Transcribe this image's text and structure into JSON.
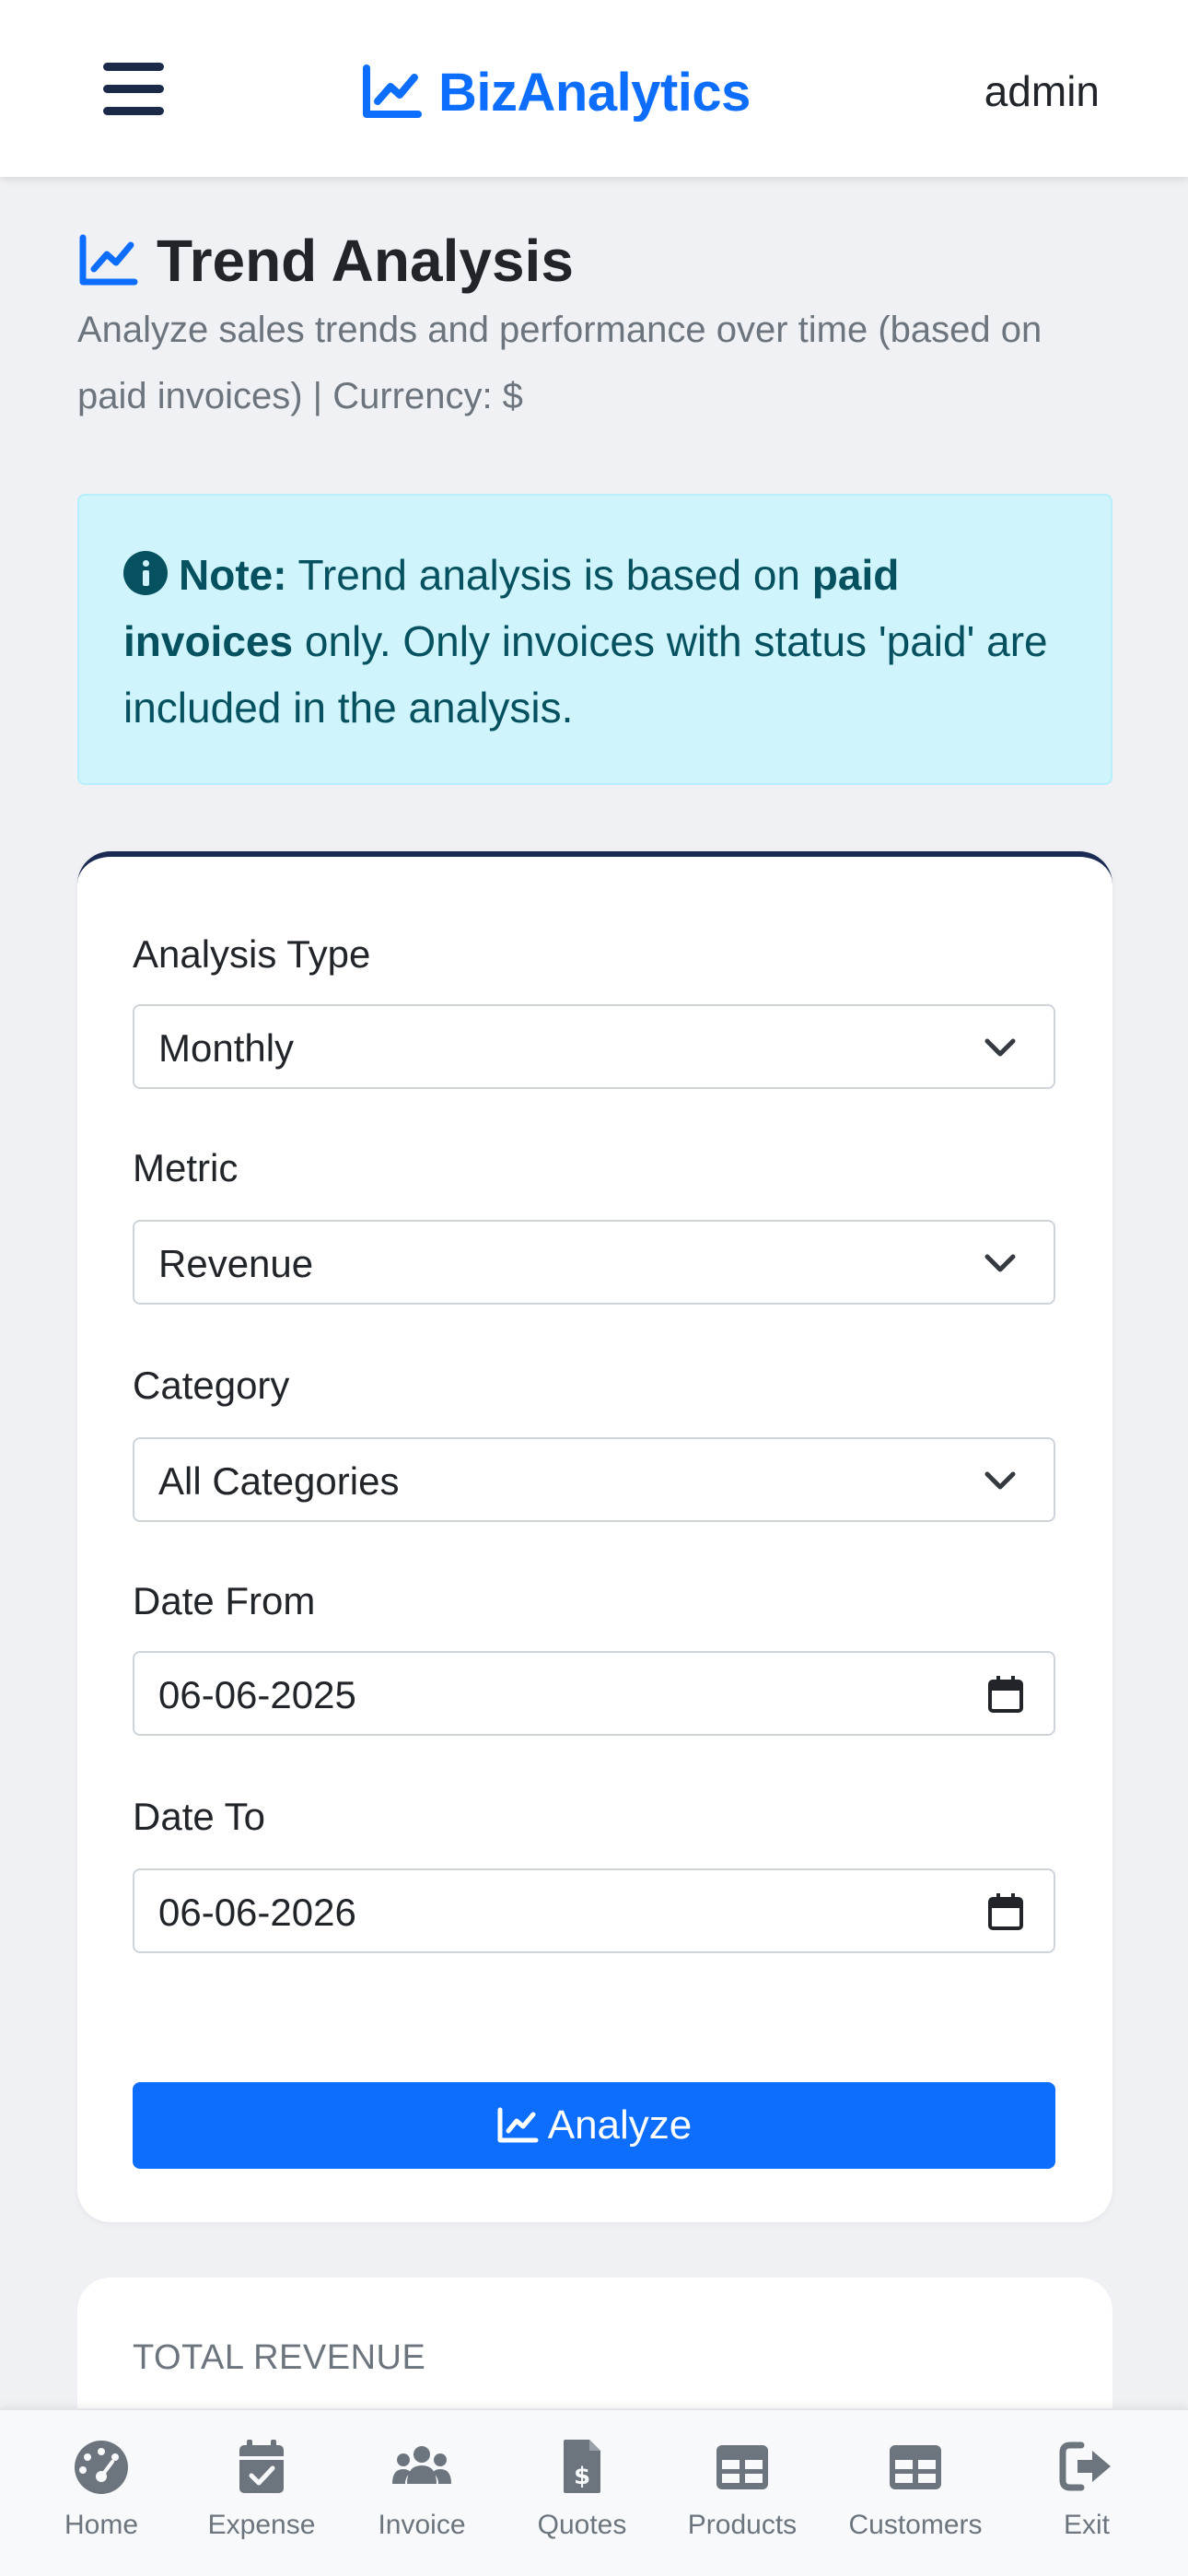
{
  "header": {
    "brand": "BizAnalytics",
    "user": "admin"
  },
  "page": {
    "title": "Trend Analysis",
    "subtitle": "Analyze sales trends and performance over time (based on paid invoices) | Currency: $"
  },
  "alert": {
    "note_label": "Note:",
    "text_1": " Trend analysis is based on ",
    "bold_1": "paid invoices",
    "text_2": " only. Only invoices with status 'paid' are included in the analysis."
  },
  "form": {
    "analysis_type_label": "Analysis Type",
    "analysis_type_value": "Monthly",
    "metric_label": "Metric",
    "metric_value": "Revenue",
    "category_label": "Category",
    "category_value": "All Categories",
    "date_from_label": "Date From",
    "date_from_value": "06-06-2025",
    "date_to_label": "Date To",
    "date_to_value": "06-06-2026",
    "analyze_button": "Analyze"
  },
  "stats": {
    "total_revenue_label": "TOTAL REVENUE"
  },
  "bottom_nav": {
    "items": [
      {
        "label": "Home",
        "icon": "gauge-icon"
      },
      {
        "label": "Expense",
        "icon": "calendar-check-icon"
      },
      {
        "label": "Invoice",
        "icon": "users-icon"
      },
      {
        "label": "Quotes",
        "icon": "file-dollar-icon"
      },
      {
        "label": "Products",
        "icon": "table-icon"
      },
      {
        "label": "Customers",
        "icon": "table-icon"
      },
      {
        "label": "Exit",
        "icon": "sign-out-icon"
      }
    ]
  },
  "colors": {
    "primary": "#0d6efd",
    "navy": "#1c2a4a",
    "alert_bg": "#cff4fc",
    "alert_text": "#055160",
    "muted": "#6c757d",
    "page_bg": "#f0f1f5"
  }
}
